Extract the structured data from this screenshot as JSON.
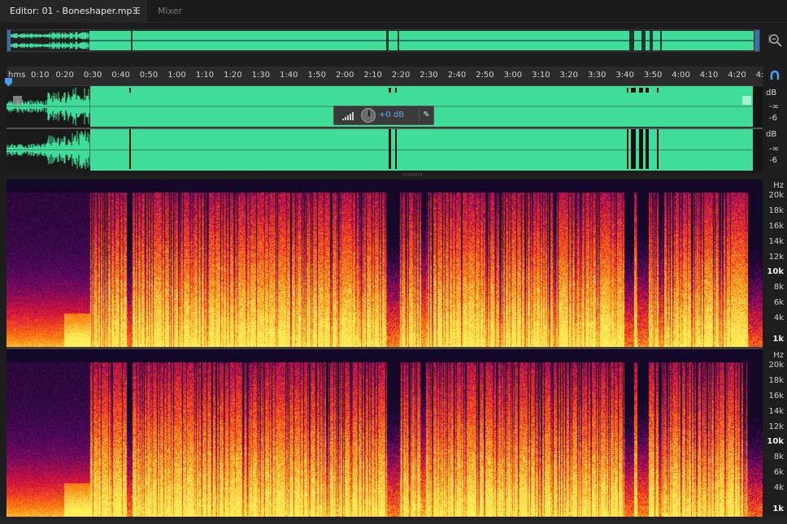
{
  "tabs": [
    {
      "label": "Editor: 01 - Boneshaper.mp3",
      "active": true
    },
    {
      "label": "Mixer",
      "active": false
    }
  ],
  "ruler": {
    "unit": "hms",
    "ticks": [
      "0:10",
      "0:20",
      "0:30",
      "0:40",
      "0:50",
      "1:00",
      "1:10",
      "1:20",
      "1:30",
      "1:40",
      "1:50",
      "2:00",
      "2:10",
      "2:20",
      "2:30",
      "2:40",
      "2:50",
      "3:00",
      "3:10",
      "3:20",
      "3:30",
      "3:40",
      "3:50",
      "4:00",
      "4:10",
      "4:20",
      "4:"
    ]
  },
  "hud": {
    "gain": "+0 dB"
  },
  "db_scale": {
    "unit": "dB",
    "labels": [
      "-∞",
      "-6"
    ]
  },
  "hz_scale": {
    "unit": "Hz",
    "labels": [
      "20k",
      "18k",
      "16k",
      "14k",
      "12k",
      "10k",
      "8k",
      "6k",
      "4k",
      "1k"
    ]
  },
  "colors": {
    "waveform": "#3fdc9a",
    "accent": "#5fa7e6",
    "background": "#1d1d1d"
  }
}
